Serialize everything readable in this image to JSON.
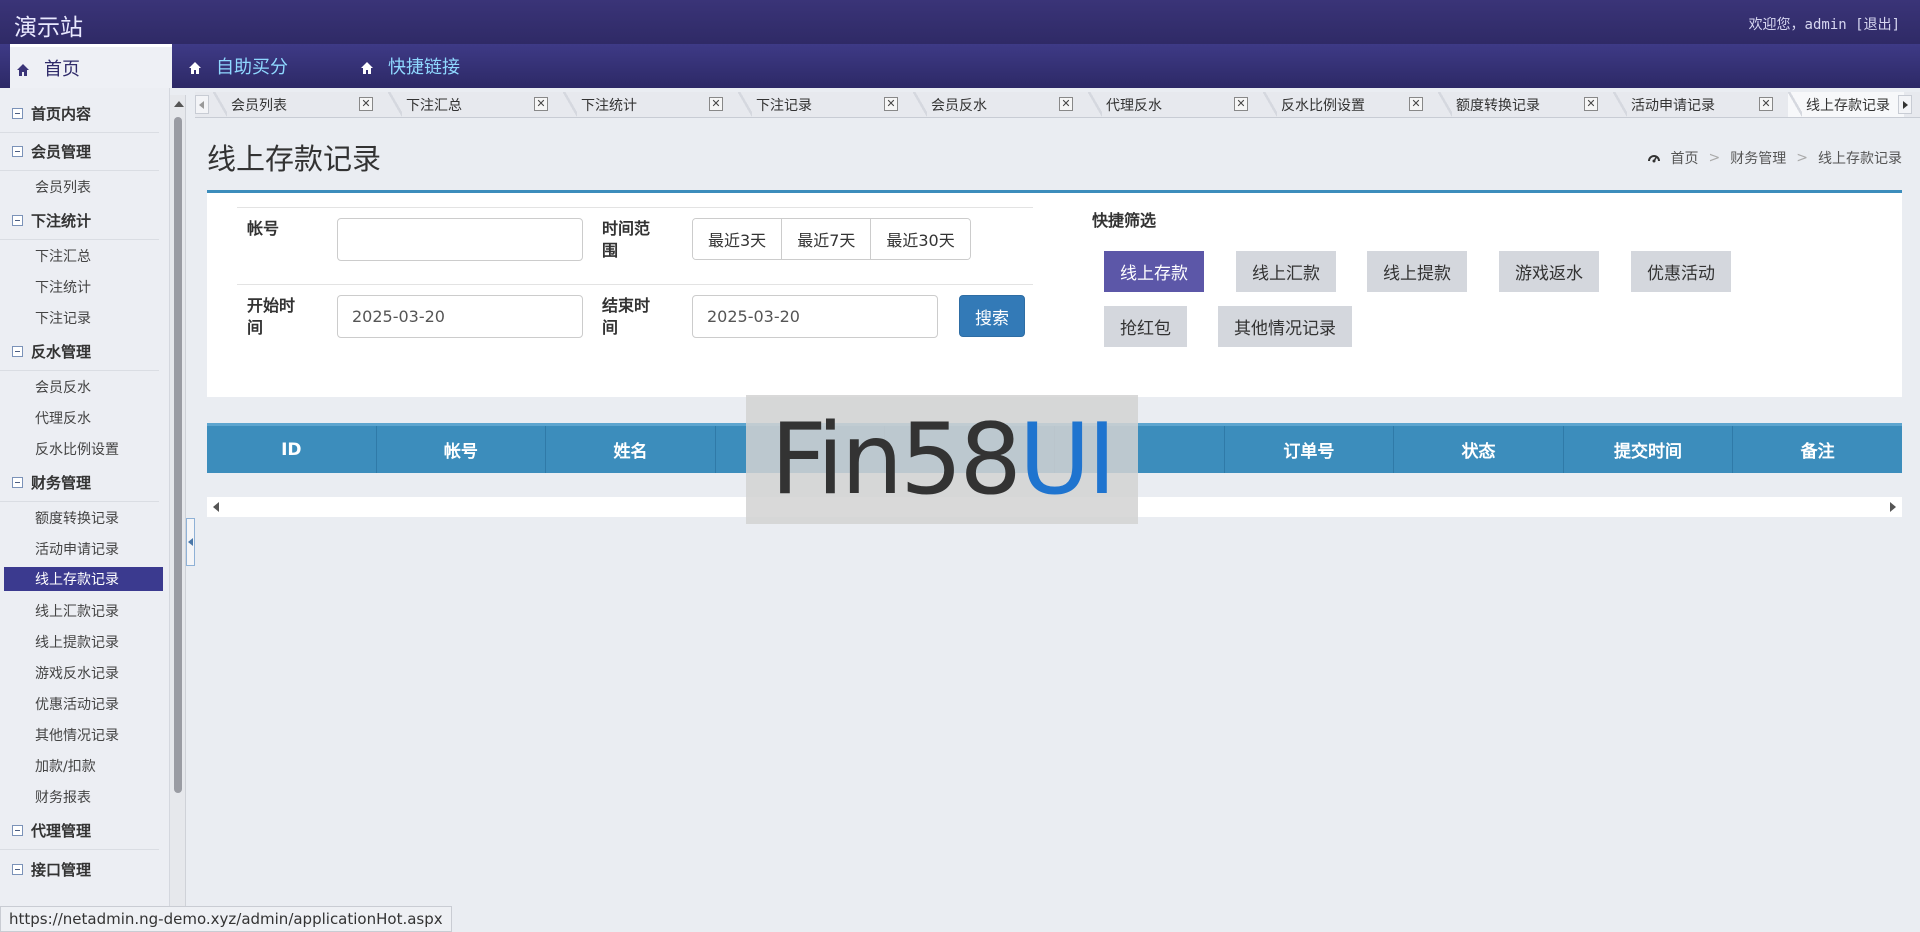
{
  "header": {
    "site_title": "演示站",
    "welcome": "欢迎您，admin [退出]"
  },
  "nav": {
    "items": [
      {
        "label": "首页",
        "icon": "home-icon"
      },
      {
        "label": "自助买分",
        "icon": "home-icon"
      },
      {
        "label": "快捷链接",
        "icon": "home-icon"
      }
    ]
  },
  "sidebar": {
    "groups": [
      {
        "label": "首页内容",
        "items": []
      },
      {
        "label": "会员管理",
        "items": [
          "会员列表"
        ]
      },
      {
        "label": "下注统计",
        "items": [
          "下注汇总",
          "下注统计",
          "下注记录"
        ]
      },
      {
        "label": "反水管理",
        "items": [
          "会员反水",
          "代理反水",
          "反水比例设置"
        ]
      },
      {
        "label": "财务管理",
        "items": [
          "额度转换记录",
          "活动申请记录",
          "线上存款记录",
          "线上汇款记录",
          "线上提款记录",
          "游戏反水记录",
          "优惠活动记录",
          "其他情况记录",
          "加款/扣款",
          "财务报表"
        ]
      },
      {
        "label": "代理管理",
        "items": []
      },
      {
        "label": "接口管理",
        "items": []
      }
    ],
    "active_item": "线上存款记录"
  },
  "tabs": [
    "会员列表",
    "下注汇总",
    "下注统计",
    "下注记录",
    "会员反水",
    "代理反水",
    "反水比例设置",
    "额度转换记录",
    "活动申请记录",
    "线上存款记录"
  ],
  "page": {
    "title": "线上存款记录",
    "breadcrumb": [
      "首页",
      "财务管理",
      "线上存款记录"
    ]
  },
  "filter": {
    "account_label": "帐号",
    "account_value": "",
    "time_range_label": "时间范围",
    "time_ranges": [
      "最近3天",
      "最近7天",
      "最近30天"
    ],
    "start_label": "开始时间",
    "start_value": "2025-03-20",
    "end_label": "结束时间",
    "end_value": "2025-03-20",
    "search_label": "搜索"
  },
  "quick_filter": {
    "title": "快捷筛选",
    "buttons": [
      "线上存款",
      "线上汇款",
      "线上提款",
      "游戏返水",
      "优惠活动",
      "抢红包",
      "其他情况记录"
    ],
    "active": "线上存款"
  },
  "table": {
    "columns": [
      "ID",
      "帐号",
      "姓名",
      "",
      "",
      "",
      "订单号",
      "状态",
      "提交时间",
      "备注"
    ]
  },
  "watermark": {
    "part1": "Fin58",
    "part2": "UI"
  },
  "status_url": "https://netadmin.ng-demo.xyz/admin/applicationHot.aspx",
  "colors": {
    "topbar": "#2f2a66",
    "accent_blue": "#3c8dbc",
    "active_purple": "#5c57a8"
  }
}
